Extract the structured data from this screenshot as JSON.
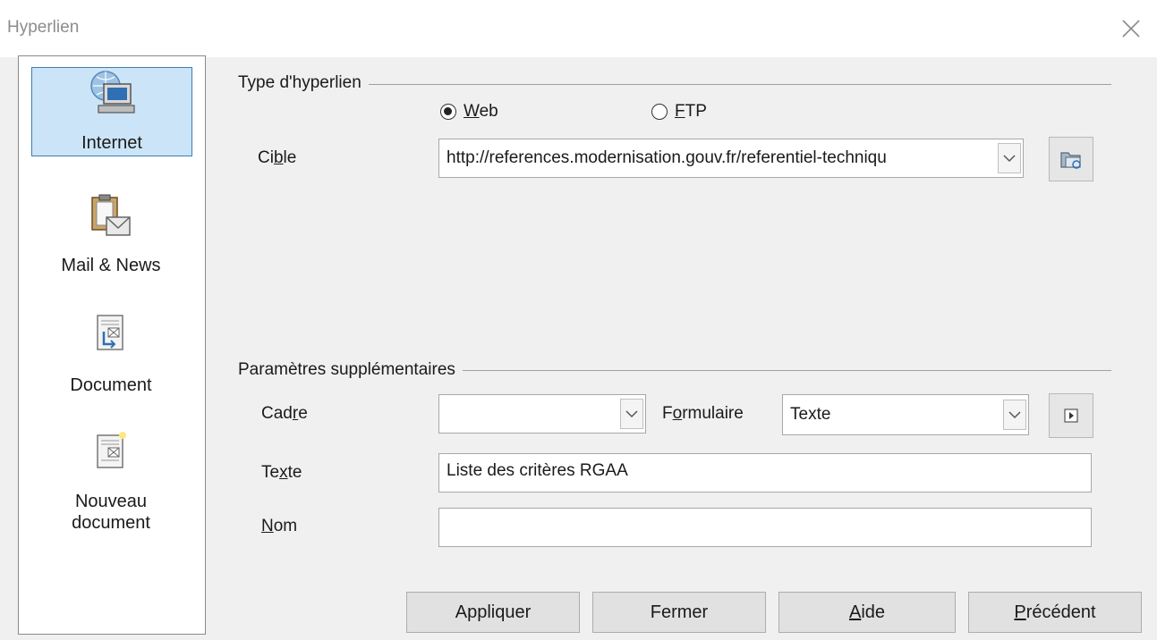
{
  "window": {
    "title": "Hyperlien",
    "close_icon": "close-icon"
  },
  "sidebar": {
    "items": [
      {
        "label": "Internet",
        "icon": "globe-computer-icon",
        "selected": true
      },
      {
        "label": "Mail & News",
        "icon": "clipboard-envelope-icon",
        "selected": false
      },
      {
        "label": "Document",
        "icon": "document-icon",
        "selected": false
      },
      {
        "label": "Nouveau document",
        "label_line1": "Nouveau",
        "label_line2": "document",
        "icon": "new-document-icon",
        "selected": false
      }
    ]
  },
  "hyperlink_type": {
    "group_title": "Type d'hyperlien",
    "options": [
      {
        "label": "Web",
        "underline": "W",
        "rest": "eb",
        "checked": true
      },
      {
        "label": "FTP",
        "underline": "F",
        "rest": "TP",
        "checked": false
      }
    ],
    "target": {
      "label_before": "Ci",
      "label_underline": "b",
      "label_after": "le",
      "value": "http://references.modernisation.gouv.fr/referentiel-techniqu",
      "browse_icon": "open-folder-icon"
    }
  },
  "extra_params": {
    "group_title": "Paramètres supplémentaires",
    "frame": {
      "label_before": "Cad",
      "label_underline": "r",
      "label_after": "e",
      "value": ""
    },
    "form": {
      "label_before": "F",
      "label_underline": "o",
      "label_after": "rmulaire",
      "value": "Texte",
      "events_icon": "play-macro-icon"
    },
    "text": {
      "label_before": "Te",
      "label_underline": "x",
      "label_after": "te",
      "value": "Liste des critères RGAA"
    },
    "name": {
      "label_before": "",
      "label_underline": "N",
      "label_after": "om",
      "value": ""
    }
  },
  "buttons": {
    "apply": "Appliquer",
    "close": "Fermer",
    "help_underline": "A",
    "help_rest": "ide",
    "back_underline": "P",
    "back_rest": "récédent"
  },
  "colors": {
    "selection_bg": "#cce4f7",
    "selection_border": "#3c7fb1",
    "dialog_bg": "#f0f0f0"
  }
}
